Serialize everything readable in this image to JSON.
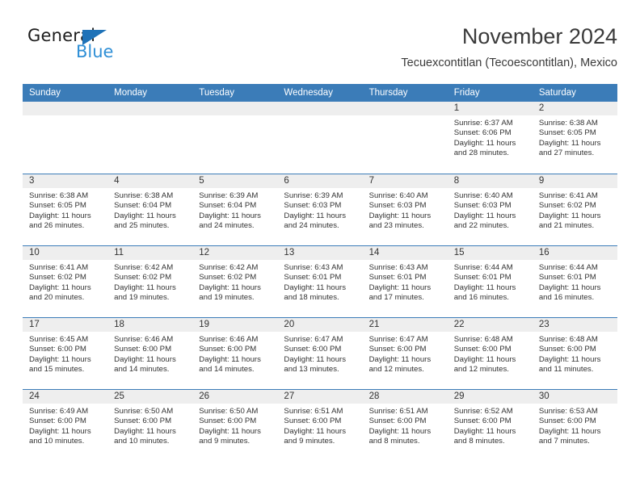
{
  "logo": {
    "text_primary": "General",
    "text_secondary": "Blue",
    "triangle_icon": "triangle-icon",
    "accent_color": "#1e72b8",
    "secondary_color": "#2f8fd6"
  },
  "header": {
    "title": "November 2024",
    "subtitle": "Tecuexcontitlan (Tecoescontitlan), Mexico"
  },
  "calendar": {
    "header_color": "#3b7cb8",
    "day_band_color": "#eeeeee",
    "weekday_headers": [
      "Sunday",
      "Monday",
      "Tuesday",
      "Wednesday",
      "Thursday",
      "Friday",
      "Saturday"
    ],
    "weeks": [
      [
        {
          "day": "",
          "sunrise": "",
          "sunset": "",
          "daylight": ""
        },
        {
          "day": "",
          "sunrise": "",
          "sunset": "",
          "daylight": ""
        },
        {
          "day": "",
          "sunrise": "",
          "sunset": "",
          "daylight": ""
        },
        {
          "day": "",
          "sunrise": "",
          "sunset": "",
          "daylight": ""
        },
        {
          "day": "",
          "sunrise": "",
          "sunset": "",
          "daylight": ""
        },
        {
          "day": "1",
          "sunrise": "Sunrise: 6:37 AM",
          "sunset": "Sunset: 6:06 PM",
          "daylight": "Daylight: 11 hours and 28 minutes."
        },
        {
          "day": "2",
          "sunrise": "Sunrise: 6:38 AM",
          "sunset": "Sunset: 6:05 PM",
          "daylight": "Daylight: 11 hours and 27 minutes."
        }
      ],
      [
        {
          "day": "3",
          "sunrise": "Sunrise: 6:38 AM",
          "sunset": "Sunset: 6:05 PM",
          "daylight": "Daylight: 11 hours and 26 minutes."
        },
        {
          "day": "4",
          "sunrise": "Sunrise: 6:38 AM",
          "sunset": "Sunset: 6:04 PM",
          "daylight": "Daylight: 11 hours and 25 minutes."
        },
        {
          "day": "5",
          "sunrise": "Sunrise: 6:39 AM",
          "sunset": "Sunset: 6:04 PM",
          "daylight": "Daylight: 11 hours and 24 minutes."
        },
        {
          "day": "6",
          "sunrise": "Sunrise: 6:39 AM",
          "sunset": "Sunset: 6:03 PM",
          "daylight": "Daylight: 11 hours and 24 minutes."
        },
        {
          "day": "7",
          "sunrise": "Sunrise: 6:40 AM",
          "sunset": "Sunset: 6:03 PM",
          "daylight": "Daylight: 11 hours and 23 minutes."
        },
        {
          "day": "8",
          "sunrise": "Sunrise: 6:40 AM",
          "sunset": "Sunset: 6:03 PM",
          "daylight": "Daylight: 11 hours and 22 minutes."
        },
        {
          "day": "9",
          "sunrise": "Sunrise: 6:41 AM",
          "sunset": "Sunset: 6:02 PM",
          "daylight": "Daylight: 11 hours and 21 minutes."
        }
      ],
      [
        {
          "day": "10",
          "sunrise": "Sunrise: 6:41 AM",
          "sunset": "Sunset: 6:02 PM",
          "daylight": "Daylight: 11 hours and 20 minutes."
        },
        {
          "day": "11",
          "sunrise": "Sunrise: 6:42 AM",
          "sunset": "Sunset: 6:02 PM",
          "daylight": "Daylight: 11 hours and 19 minutes."
        },
        {
          "day": "12",
          "sunrise": "Sunrise: 6:42 AM",
          "sunset": "Sunset: 6:02 PM",
          "daylight": "Daylight: 11 hours and 19 minutes."
        },
        {
          "day": "13",
          "sunrise": "Sunrise: 6:43 AM",
          "sunset": "Sunset: 6:01 PM",
          "daylight": "Daylight: 11 hours and 18 minutes."
        },
        {
          "day": "14",
          "sunrise": "Sunrise: 6:43 AM",
          "sunset": "Sunset: 6:01 PM",
          "daylight": "Daylight: 11 hours and 17 minutes."
        },
        {
          "day": "15",
          "sunrise": "Sunrise: 6:44 AM",
          "sunset": "Sunset: 6:01 PM",
          "daylight": "Daylight: 11 hours and 16 minutes."
        },
        {
          "day": "16",
          "sunrise": "Sunrise: 6:44 AM",
          "sunset": "Sunset: 6:01 PM",
          "daylight": "Daylight: 11 hours and 16 minutes."
        }
      ],
      [
        {
          "day": "17",
          "sunrise": "Sunrise: 6:45 AM",
          "sunset": "Sunset: 6:00 PM",
          "daylight": "Daylight: 11 hours and 15 minutes."
        },
        {
          "day": "18",
          "sunrise": "Sunrise: 6:46 AM",
          "sunset": "Sunset: 6:00 PM",
          "daylight": "Daylight: 11 hours and 14 minutes."
        },
        {
          "day": "19",
          "sunrise": "Sunrise: 6:46 AM",
          "sunset": "Sunset: 6:00 PM",
          "daylight": "Daylight: 11 hours and 14 minutes."
        },
        {
          "day": "20",
          "sunrise": "Sunrise: 6:47 AM",
          "sunset": "Sunset: 6:00 PM",
          "daylight": "Daylight: 11 hours and 13 minutes."
        },
        {
          "day": "21",
          "sunrise": "Sunrise: 6:47 AM",
          "sunset": "Sunset: 6:00 PM",
          "daylight": "Daylight: 11 hours and 12 minutes."
        },
        {
          "day": "22",
          "sunrise": "Sunrise: 6:48 AM",
          "sunset": "Sunset: 6:00 PM",
          "daylight": "Daylight: 11 hours and 12 minutes."
        },
        {
          "day": "23",
          "sunrise": "Sunrise: 6:48 AM",
          "sunset": "Sunset: 6:00 PM",
          "daylight": "Daylight: 11 hours and 11 minutes."
        }
      ],
      [
        {
          "day": "24",
          "sunrise": "Sunrise: 6:49 AM",
          "sunset": "Sunset: 6:00 PM",
          "daylight": "Daylight: 11 hours and 10 minutes."
        },
        {
          "day": "25",
          "sunrise": "Sunrise: 6:50 AM",
          "sunset": "Sunset: 6:00 PM",
          "daylight": "Daylight: 11 hours and 10 minutes."
        },
        {
          "day": "26",
          "sunrise": "Sunrise: 6:50 AM",
          "sunset": "Sunset: 6:00 PM",
          "daylight": "Daylight: 11 hours and 9 minutes."
        },
        {
          "day": "27",
          "sunrise": "Sunrise: 6:51 AM",
          "sunset": "Sunset: 6:00 PM",
          "daylight": "Daylight: 11 hours and 9 minutes."
        },
        {
          "day": "28",
          "sunrise": "Sunrise: 6:51 AM",
          "sunset": "Sunset: 6:00 PM",
          "daylight": "Daylight: 11 hours and 8 minutes."
        },
        {
          "day": "29",
          "sunrise": "Sunrise: 6:52 AM",
          "sunset": "Sunset: 6:00 PM",
          "daylight": "Daylight: 11 hours and 8 minutes."
        },
        {
          "day": "30",
          "sunrise": "Sunrise: 6:53 AM",
          "sunset": "Sunset: 6:00 PM",
          "daylight": "Daylight: 11 hours and 7 minutes."
        }
      ]
    ]
  }
}
